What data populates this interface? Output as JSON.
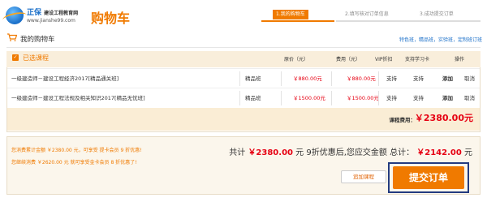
{
  "brand": {
    "name": "正保",
    "subname": "建设工程教育网",
    "url": "www.jianshe99.com"
  },
  "page_title": "购物车",
  "steps": [
    {
      "label": "1.我的购物车"
    },
    {
      "label": "2.填写核对订单信息"
    },
    {
      "label": "3.成功提交订单"
    }
  ],
  "cart": {
    "title": "我的购物车",
    "top_links": "特色班，精品班，实验班，定制班订班"
  },
  "table": {
    "selected_label": "已选课程",
    "headers": {
      "price": "原价（元）",
      "fee": "费用（元）",
      "vip": "VIP折扣",
      "card": "支持学习卡",
      "ops": "操作"
    },
    "rows": [
      {
        "name": "一级建造师－建设工程经济2017[精品通关班]",
        "type": "精品班",
        "price": "￥880.00元",
        "fee": "￥880.00元",
        "vip": "支持",
        "card": "支持",
        "add": "添加",
        "cancel": "取消"
      },
      {
        "name": "一级建造师－建设工程法规及相关知识2017[精品无忧班]",
        "type": "精品班",
        "price": "￥1500.00元",
        "fee": "￥1500.00元",
        "vip": "支持",
        "card": "支持",
        "add": "添加",
        "cancel": "取消"
      }
    ],
    "fee_label": "课程费用：",
    "fee_total": "￥2380.00元"
  },
  "summary": {
    "note1": "您消费累计金额 ￥2380.00 元，可享受 提卡会员 9 折优惠!",
    "note2": "您继续消费 ￥2620.00 元 就可享受金卡会员 8 折优惠了!",
    "total_prefix": "共计",
    "total": "￥2380.00",
    "total_mid": "元 9折优惠后,您应交金额 总计：",
    "pay": "￥2142.00",
    "unit": "元",
    "more_button": "追加课程",
    "submit_button": "提交订单"
  },
  "colors": {
    "accent": "#f07a00",
    "price_red": "#e60012",
    "brand_blue": "#1a6fc9"
  }
}
